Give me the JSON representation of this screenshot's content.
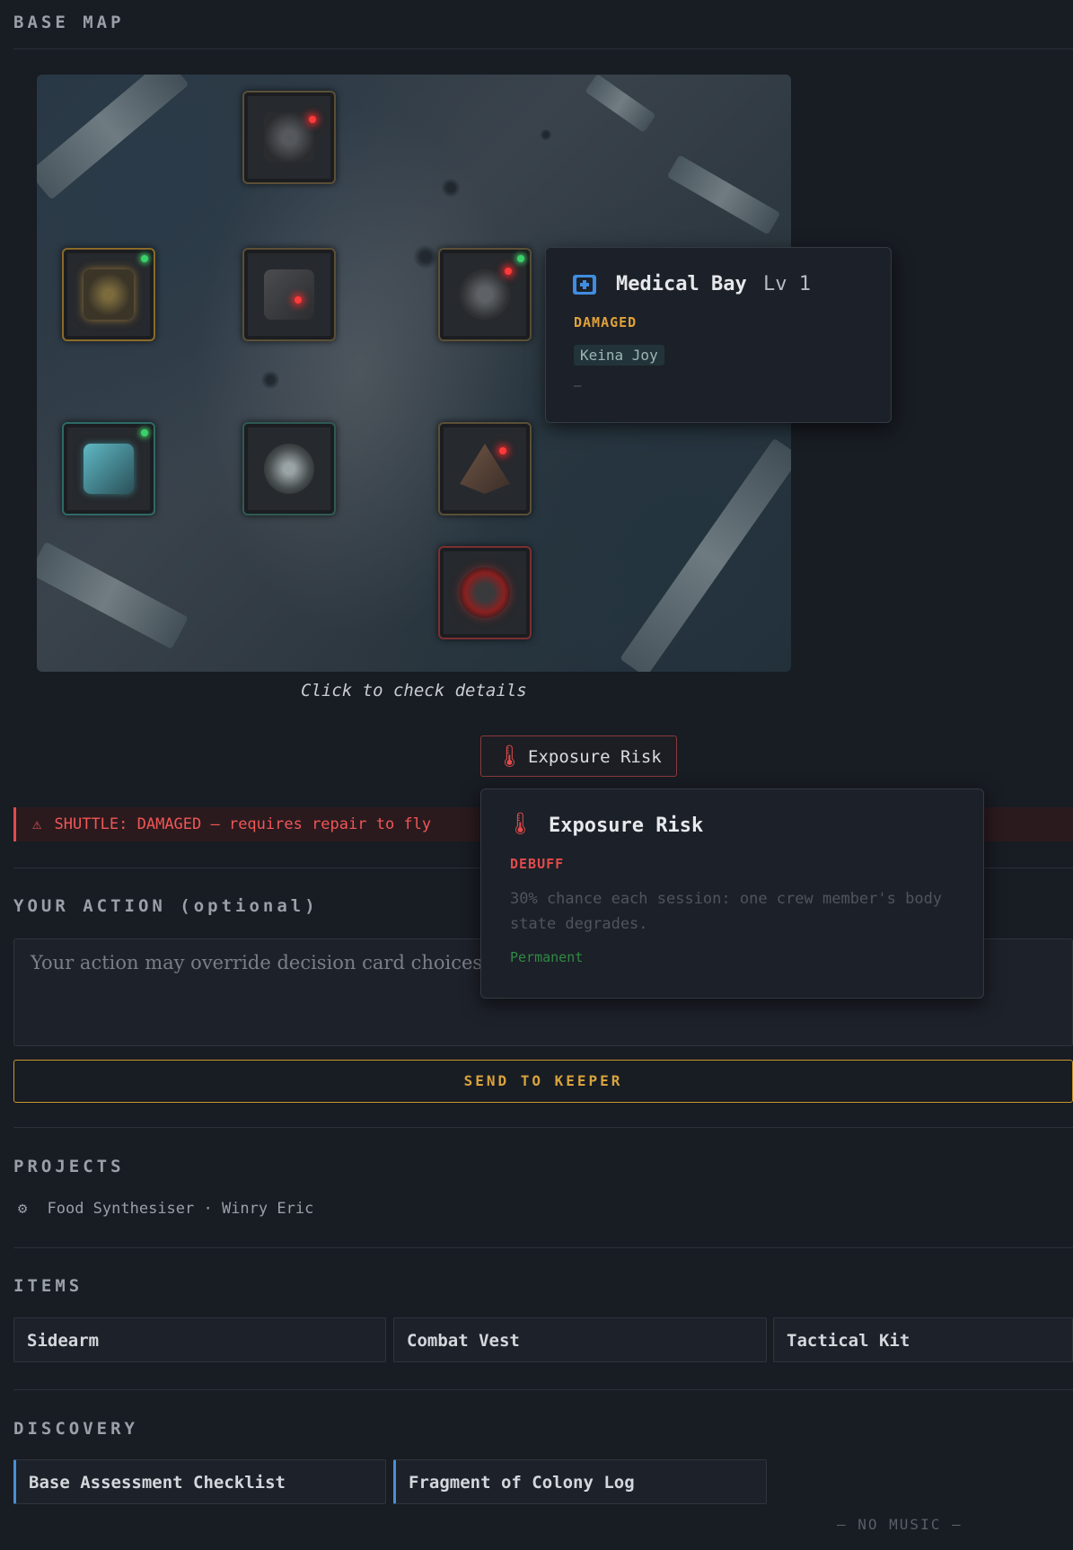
{
  "base_map": {
    "title": "BASE MAP",
    "hint": "Click to check details",
    "buildings": [
      {
        "name": "building-top",
        "status": "damaged"
      },
      {
        "name": "building-command",
        "status": "online"
      },
      {
        "name": "building-workshop",
        "status": "damaged"
      },
      {
        "name": "building-medical-bay",
        "status": "damaged"
      },
      {
        "name": "building-storage",
        "status": "online"
      },
      {
        "name": "building-reactor",
        "status": "idle"
      },
      {
        "name": "building-shuttle",
        "status": "damaged"
      },
      {
        "name": "building-generator",
        "status": "critical"
      }
    ]
  },
  "medical_tooltip": {
    "name": "Medical Bay",
    "level": "Lv 1",
    "status": "DAMAGED",
    "crew": "Keina Joy",
    "note": "—"
  },
  "effect_button": {
    "label": "Exposure Risk"
  },
  "effect_tooltip": {
    "title": "Exposure Risk",
    "type": "DEBUFF",
    "description": "30% chance each session: one crew member's body state degrades.",
    "duration": "Permanent"
  },
  "alert": {
    "icon": "⚠",
    "text": "SHUTTLE: DAMAGED — requires repair to fly"
  },
  "action": {
    "title": "YOUR ACTION (optional)",
    "placeholder": "Your action may override decision card choices —",
    "send_label": "SEND TO KEEPER"
  },
  "projects": {
    "title": "PROJECTS",
    "items": [
      {
        "icon": "⚙",
        "text": "Food Synthesiser · Winry Eric"
      }
    ]
  },
  "items": {
    "title": "ITEMS",
    "list": [
      "Sidearm",
      "Combat Vest",
      "Tactical Kit"
    ]
  },
  "discovery": {
    "title": "DISCOVERY",
    "list": [
      "Base Assessment Checklist",
      "Fragment of Colony Log"
    ]
  },
  "music": {
    "status": "— NO MUSIC —"
  },
  "colors": {
    "accent": "#d8a33e",
    "danger": "#e14b4b",
    "link": "#4a8fd8",
    "success": "#2f8a44"
  }
}
